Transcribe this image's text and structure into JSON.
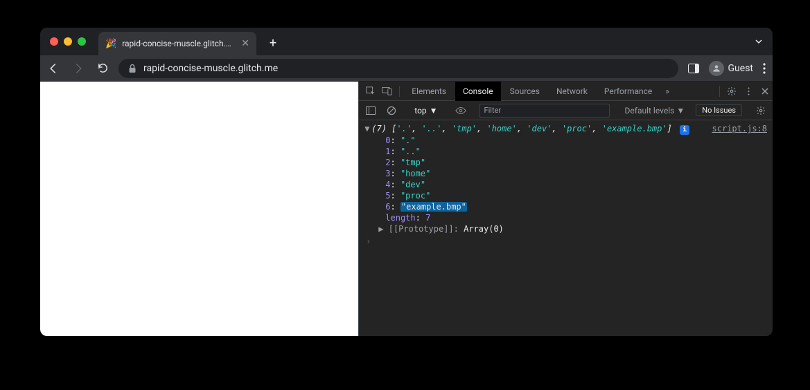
{
  "tab": {
    "favicon": "🎉",
    "title": "rapid-concise-muscle.glitch.me"
  },
  "omnibox": {
    "url": "rapid-concise-muscle.glitch.me"
  },
  "guest_label": "Guest",
  "devtools": {
    "tabs": [
      "Elements",
      "Console",
      "Sources",
      "Network",
      "Performance"
    ],
    "active_tab": 1,
    "context": "top",
    "filter_placeholder": "Filter",
    "levels_label": "Default levels",
    "issues_label": "No Issues"
  },
  "console": {
    "source_link": "script.js:8",
    "array_length_label": "(7)",
    "array_preview": [
      "'.'",
      "'..'",
      "'tmp'",
      "'home'",
      "'dev'",
      "'proc'",
      "'example.bmp'"
    ],
    "entries": [
      {
        "index": "0",
        "value": "\".\""
      },
      {
        "index": "1",
        "value": "\"..\""
      },
      {
        "index": "2",
        "value": "\"tmp\""
      },
      {
        "index": "3",
        "value": "\"home\""
      },
      {
        "index": "4",
        "value": "\"dev\""
      },
      {
        "index": "5",
        "value": "\"proc\""
      },
      {
        "index": "6",
        "value": "\"example.bmp\"",
        "highlighted": true
      }
    ],
    "length_key": "length",
    "length_value": "7",
    "prototype_label": "[[Prototype]]",
    "prototype_value": "Array(0)"
  }
}
